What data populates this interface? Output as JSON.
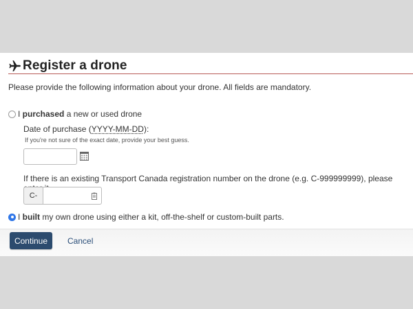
{
  "page": {
    "title": "Register a drone",
    "intro": "Please provide the following information about your drone. All fields are mandatory.",
    "title_icon": "plane-icon"
  },
  "option_purchased": {
    "prefix": "I ",
    "bold": "purchased",
    "suffix": " a new or used drone",
    "selected": false
  },
  "purchase_date": {
    "label_prefix": "Date of purchase (",
    "label_format": "YYYY-MM-DD",
    "label_suffix": "):",
    "hint": "If you're not sure of the exact date, provide your best guess.",
    "value": "",
    "calendar_icon": "calendar-icon"
  },
  "registration": {
    "label": "If there is an existing Transport Canada registration number on the drone (e.g. C-999999999), please enter it.",
    "prefix": "C-",
    "value": "",
    "field_icon": "clipboard-icon"
  },
  "option_built": {
    "prefix": "I ",
    "bold": "built",
    "suffix": " my own drone using either a kit, off-the-shelf or custom-built parts.",
    "selected": true
  },
  "actions": {
    "continue_label": "Continue",
    "cancel_label": "Cancel"
  },
  "colors": {
    "accent_rule": "#b85c57",
    "primary_button": "#2c4b6e",
    "radio_selected": "#2f76e8",
    "link": "#284c77"
  }
}
